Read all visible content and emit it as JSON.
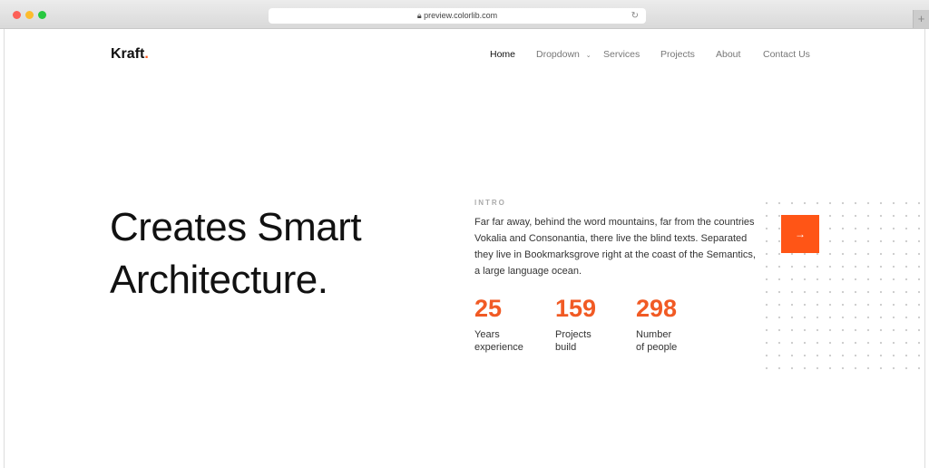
{
  "browser": {
    "url": "preview.colorlib.com",
    "lock_icon": "lock-icon",
    "reload_icon": "reload-icon",
    "new_tab": "+"
  },
  "brand": {
    "name": "Kraft",
    "dot": ".",
    "accent": "#f15a24"
  },
  "nav": {
    "items": [
      "Home",
      "Dropdown",
      "Services",
      "Projects",
      "About",
      "Contact Us"
    ],
    "active": "Home"
  },
  "hero": {
    "line1": "Creates Smart",
    "line2": "Architecture."
  },
  "intro": {
    "label": "INTRO",
    "text": "Far far away, behind the word mountains, far from the countries Vokalia and Consonantia, there live the blind texts. Separated they live in Bookmarksgrove right at the coast of the Semantics, a large language ocean."
  },
  "stats": [
    {
      "value": "25",
      "label1": "Years",
      "label2": "experience"
    },
    {
      "value": "159",
      "label1": "Projects",
      "label2": "build"
    },
    {
      "value": "298",
      "label1": "Number",
      "label2": "of people"
    }
  ],
  "cta": {
    "icon": "arrow-right-icon",
    "glyph": "→"
  }
}
